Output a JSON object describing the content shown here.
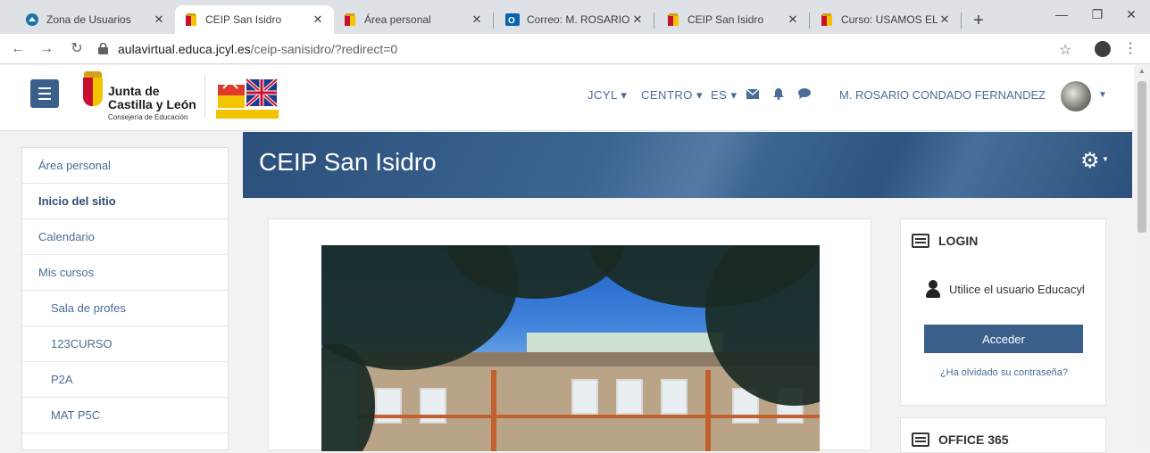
{
  "browser": {
    "tabs": [
      {
        "title": "Zona de Usuarios"
      },
      {
        "title": "CEIP San Isidro"
      },
      {
        "title": "Área personal"
      },
      {
        "title": "Correo: M. ROSARIO CC"
      },
      {
        "title": "CEIP San Isidro"
      },
      {
        "title": "Curso: USAMOS EL AUL"
      }
    ],
    "url_host": "aulavirtual.educa.jcyl.es",
    "url_path": "/ceip-sanisidro/?redirect=0"
  },
  "header": {
    "org_line1": "Junta de",
    "org_line2": "Castilla y León",
    "org_sub": "Consejería de Educación",
    "menu_jcyl": "JCYL ▾",
    "menu_centro": "CENTRO ▾",
    "menu_lang": "ES ▾",
    "username": "M. ROSARIO CONDADO FERNANDEZ"
  },
  "sidebar": {
    "items": [
      {
        "label": "Área personal"
      },
      {
        "label": "Inicio del sitio"
      },
      {
        "label": "Calendario"
      },
      {
        "label": "Mis cursos"
      },
      {
        "label": "Sala de profes"
      },
      {
        "label": "123CURSO"
      },
      {
        "label": "P2A"
      },
      {
        "label": "MAT P5C"
      }
    ]
  },
  "banner": {
    "title": "CEIP San Isidro"
  },
  "login_block": {
    "title": "LOGIN",
    "user_hint": "Utilice el usuario Educacyl",
    "button": "Acceder",
    "forgot": "¿Ha olvidado su contraseña?"
  },
  "office_block": {
    "title": "OFFICE 365"
  },
  "colors": {
    "primary": "#3b5f8b",
    "link": "#4a6d96"
  }
}
